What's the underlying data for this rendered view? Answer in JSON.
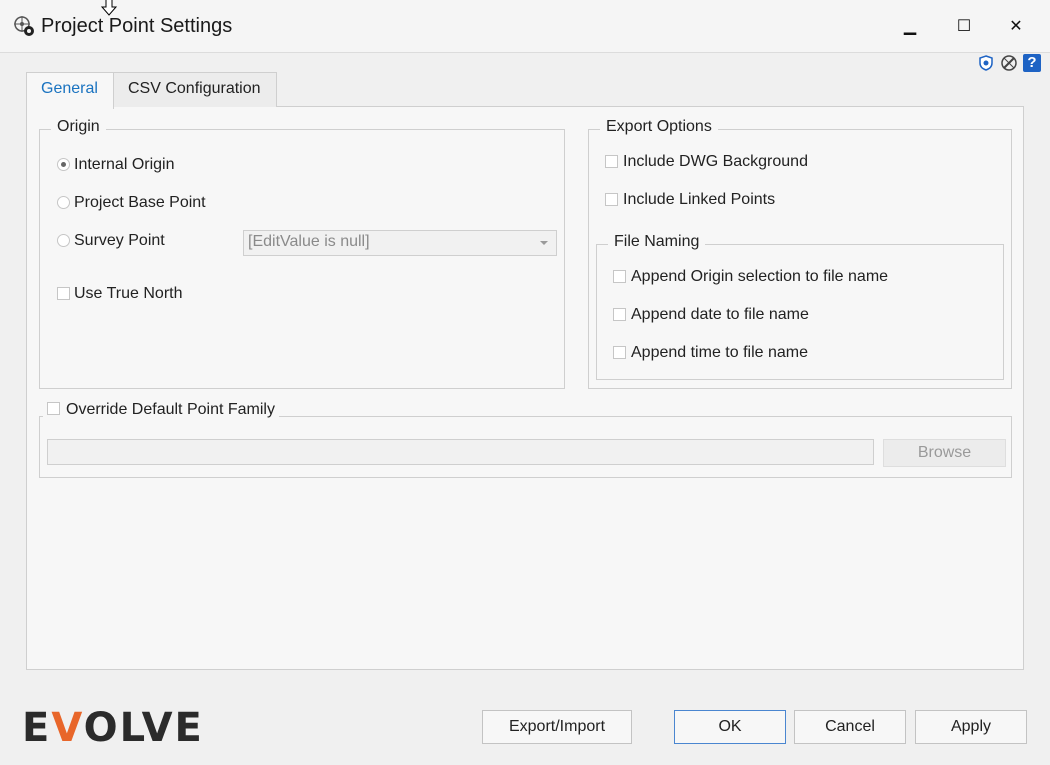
{
  "window": {
    "title": "Project Point Settings",
    "controls": {
      "minimize": "▁",
      "maximize": "☐",
      "close": "✕"
    },
    "help": "?"
  },
  "tabs": [
    {
      "label": "General",
      "selected": true
    },
    {
      "label": "CSV Configuration",
      "selected": false
    }
  ],
  "origin": {
    "legend": "Origin",
    "options": [
      {
        "label": "Internal Origin",
        "checked": true
      },
      {
        "label": "Project Base Point",
        "checked": false
      },
      {
        "label": "Survey Point",
        "checked": false
      }
    ],
    "survey_value": "[EditValue is null]",
    "use_true_north": {
      "label": "Use True North",
      "checked": false
    }
  },
  "export_options": {
    "legend": "Export Options",
    "include_dwg": {
      "label": "Include DWG Background",
      "checked": false
    },
    "include_linked": {
      "label": "Include Linked Points",
      "checked": false
    },
    "file_naming": {
      "legend": "File Naming",
      "append_origin": {
        "label": "Append Origin selection to file name",
        "checked": false
      },
      "append_date": {
        "label": "Append date to file name",
        "checked": false
      },
      "append_time": {
        "label": "Append time to file name",
        "checked": false
      }
    }
  },
  "override": {
    "label": "Override Default Point Family",
    "checked": false,
    "path_value": "",
    "browse_label": "Browse"
  },
  "footer": {
    "logo_pre": "E",
    "logo_v": "V",
    "logo_post": "OLVE",
    "export_import_label": "Export/Import",
    "ok_label": "OK",
    "cancel_label": "Cancel",
    "apply_label": "Apply"
  },
  "colors": {
    "accent": "#1a73c0",
    "brand_orange": "#e8662a"
  }
}
